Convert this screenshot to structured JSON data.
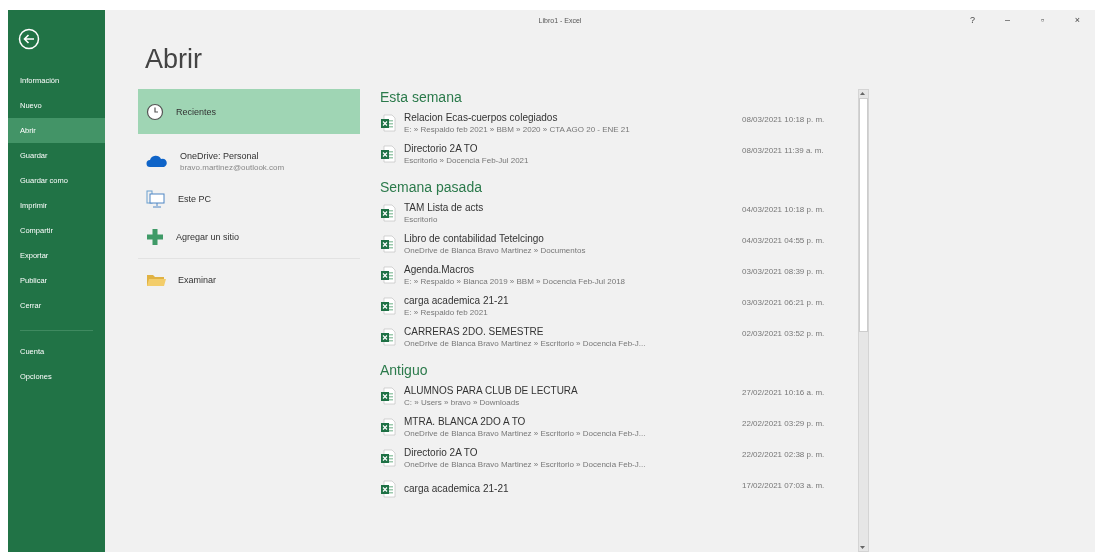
{
  "window": {
    "title": "Libro1 - Excel",
    "controls": [
      "?",
      "–",
      "▫",
      "×"
    ]
  },
  "sidebar": {
    "items": [
      {
        "label": "Información",
        "selected": false
      },
      {
        "label": "Nuevo",
        "selected": false
      },
      {
        "label": "Abrir",
        "selected": true
      },
      {
        "label": "Guardar",
        "selected": false
      },
      {
        "label": "Guardar como",
        "selected": false
      },
      {
        "label": "Imprimir",
        "selected": false
      },
      {
        "label": "Compartir",
        "selected": false
      },
      {
        "label": "Exportar",
        "selected": false
      },
      {
        "label": "Publicar",
        "selected": false
      },
      {
        "label": "Cerrar",
        "selected": false
      }
    ],
    "bottom_items": [
      {
        "label": "Cuenta",
        "selected": false
      },
      {
        "label": "Opciones",
        "selected": false
      }
    ]
  },
  "heading": "Abrir",
  "places": [
    {
      "kind": "recent",
      "label": "Recientes",
      "selected": true
    },
    {
      "kind": "cloud",
      "label": "OneDrive: Personal",
      "detail": "bravo.martinez@outlook.com",
      "selected": false
    },
    {
      "kind": "pc",
      "label": "Este PC",
      "selected": false
    },
    {
      "kind": "add",
      "label": "Agregar un sitio",
      "selected": false
    },
    {
      "kind": "browse",
      "label": "Examinar",
      "selected": false
    }
  ],
  "groups": [
    {
      "title": "Esta semana",
      "files": [
        {
          "name": "Relacion Ecas-cuerpos colegiados",
          "path": "E: » Respaldo feb 2021 » BBM » 2020 » CTA AGO 20 - ENE 21",
          "date": "08/03/2021 10:18 p. m."
        },
        {
          "name": "Directorio 2A TO",
          "path": "Escritorio » Docencia Feb-Jul 2021",
          "date": "08/03/2021 11:39 a. m."
        }
      ]
    },
    {
      "title": "Semana pasada",
      "files": [
        {
          "name": "TAM Lista de acts",
          "path": "Escritorio",
          "date": "04/03/2021 10:18 p. m."
        },
        {
          "name": "Libro de contabilidad Tetelcingo",
          "path": "OneDrive de Blanca Bravo Martinez » Documentos",
          "date": "04/03/2021 04:55 p. m."
        },
        {
          "name": "Agenda.Macros",
          "path": "E: » Respaldo » Blanca 2019 » BBM » Docencia Feb-Jul 2018",
          "date": "03/03/2021 08:39 p. m."
        },
        {
          "name": "carga academica 21-21",
          "path": "E: » Respaldo feb 2021",
          "date": "03/03/2021 06:21 p. m."
        },
        {
          "name": "CARRERAS 2DO. SEMESTRE",
          "path": "OneDrive de Blanca Bravo Martinez » Escritorio » Docencia Feb-J...",
          "date": "02/03/2021 03:52 p. m."
        }
      ]
    },
    {
      "title": "Antiguo",
      "files": [
        {
          "name": "ALUMNOS PARA CLUB DE LECTURA",
          "path": "C: » Users » bravo » Downloads",
          "date": "27/02/2021 10:16 a. m."
        },
        {
          "name": "MTRA. BLANCA 2DO A TO",
          "path": "OneDrive de Blanca Bravo Martinez » Escritorio » Docencia Feb-J...",
          "date": "22/02/2021 03:29 p. m."
        },
        {
          "name": "Directorio 2A TO",
          "path": "OneDrive de Blanca Bravo Martinez » Escritorio » Docencia Feb-J...",
          "date": "22/02/2021 02:38 p. m."
        },
        {
          "name": "carga academica 21-21",
          "date": "17/02/2021 07:03 a. m."
        }
      ]
    }
  ]
}
